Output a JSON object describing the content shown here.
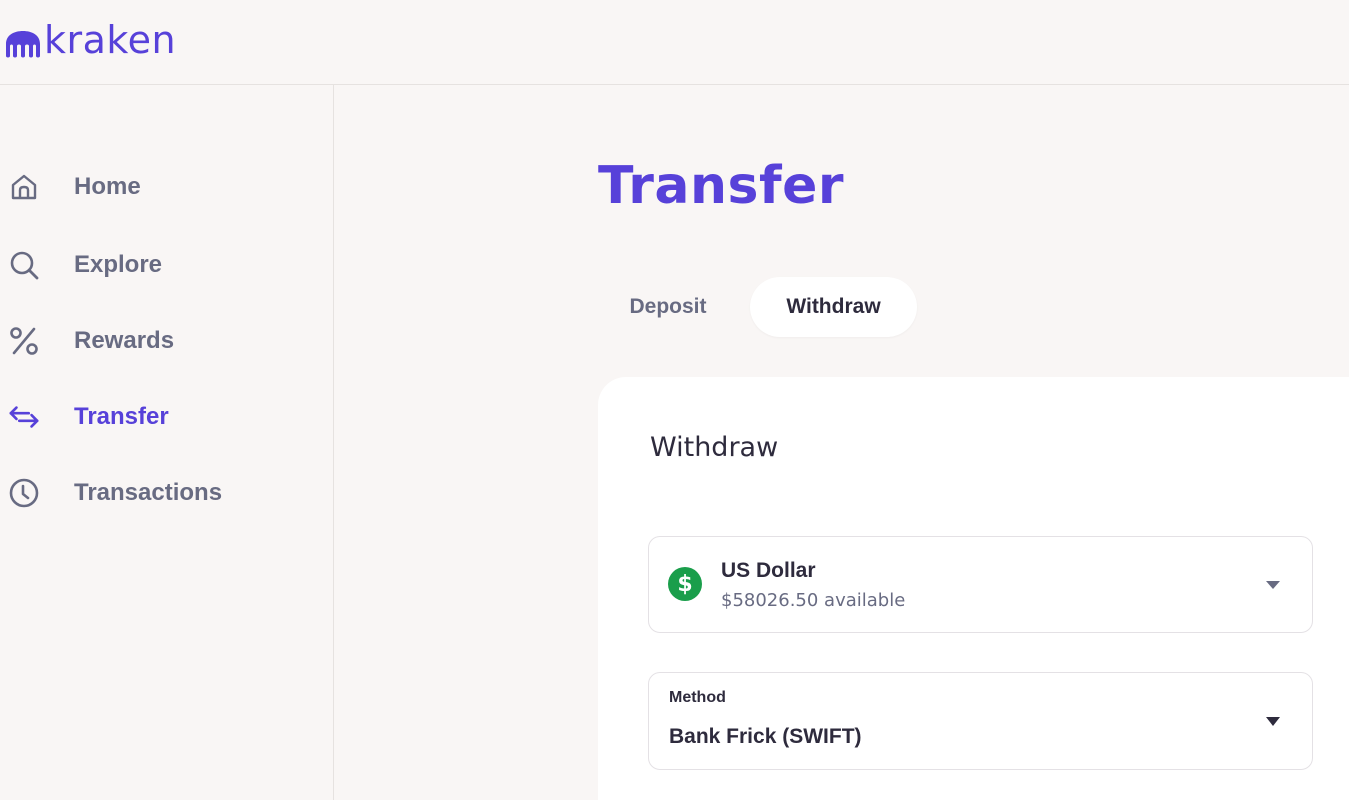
{
  "app": {
    "logo_text": "kraken",
    "brand_color": "#5741d9"
  },
  "sidebar": {
    "items": [
      {
        "label": "Home",
        "icon": "home-icon",
        "active": false
      },
      {
        "label": "Explore",
        "icon": "search-icon",
        "active": false
      },
      {
        "label": "Rewards",
        "icon": "percent-icon",
        "active": false
      },
      {
        "label": "Transfer",
        "icon": "transfer-arrows-icon",
        "active": true
      },
      {
        "label": "Transactions",
        "icon": "clock-icon",
        "active": false
      }
    ]
  },
  "main": {
    "title": "Transfer",
    "tabs": [
      {
        "label": "Deposit",
        "selected": false
      },
      {
        "label": "Withdraw",
        "selected": true
      }
    ],
    "card": {
      "title": "Withdraw",
      "currency": {
        "symbol": "$",
        "name": "US Dollar",
        "available": "$58026.50 available",
        "icon": "dollar-circle-icon",
        "icon_color": "#1a9e4b"
      },
      "method": {
        "label": "Method",
        "value": "Bank Frick (SWIFT)"
      }
    }
  }
}
